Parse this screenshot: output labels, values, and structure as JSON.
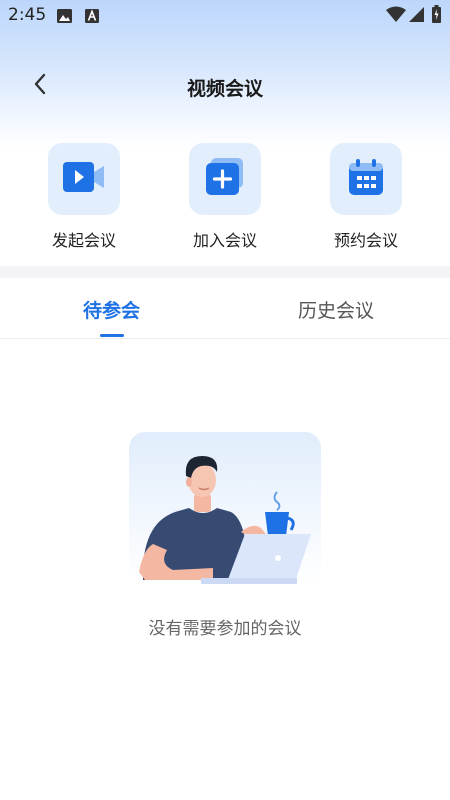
{
  "status_bar": {
    "time": "2:45",
    "icons": [
      "image-notification-icon",
      "a-notification-icon",
      "wifi-icon",
      "signal-icon",
      "battery-charging-icon"
    ]
  },
  "header": {
    "title": "视频会议"
  },
  "actions": [
    {
      "label": "发起会议",
      "icon": "video-camera-icon"
    },
    {
      "label": "加入会议",
      "icon": "plus-square-icon"
    },
    {
      "label": "预约会议",
      "icon": "calendar-icon"
    }
  ],
  "tabs": [
    {
      "label": "待参会",
      "active": true
    },
    {
      "label": "历史会议",
      "active": false
    }
  ],
  "empty_state": {
    "message": "没有需要参加的会议",
    "illustration": "person-with-laptop-and-coffee"
  },
  "colors": {
    "accent": "#1f72e5",
    "tile_bg": "#e3eefc",
    "header_gradient_top": "#bcd6fb"
  }
}
